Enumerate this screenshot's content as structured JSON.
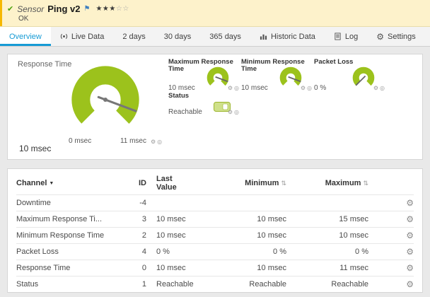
{
  "header": {
    "check_icon": "✔",
    "kind_label": "Sensor",
    "title": "Ping v2",
    "flag_icon": "⚑",
    "stars_filled": "★★★",
    "stars_empty": "☆☆",
    "status": "OK"
  },
  "tabs": [
    {
      "label": "Overview"
    },
    {
      "label": "Live Data",
      "icon": "live-data-icon"
    },
    {
      "label": "2 days"
    },
    {
      "label": "30 days"
    },
    {
      "label": "365 days"
    },
    {
      "label": "Historic Data",
      "icon": "bar-chart-icon"
    },
    {
      "label": "Log",
      "icon": "log-icon"
    },
    {
      "label": "Settings",
      "icon": "gear-icon"
    }
  ],
  "overview": {
    "gauge_title": "Response Time",
    "gauge": {
      "min_label": "0 msec",
      "max_label": "11 msec",
      "value": "10 msec"
    },
    "mini_gauges": [
      {
        "title": "Maximum Response Time",
        "value": "10 msec"
      },
      {
        "title": "Minimum Response Time",
        "value": "10 msec"
      },
      {
        "title": "Packet Loss",
        "value": "0 %"
      }
    ],
    "status": {
      "title": "Status",
      "value": "Reachable"
    }
  },
  "table": {
    "headers": {
      "channel": "Channel",
      "id": "ID",
      "last_value": "Last Value",
      "minimum": "Minimum",
      "maximum": "Maximum"
    },
    "rows": [
      {
        "channel": "Downtime",
        "id": "-4",
        "last": "",
        "min": "",
        "max": ""
      },
      {
        "channel": "Maximum Response Ti...",
        "id": "3",
        "last": "10 msec",
        "min": "10 msec",
        "max": "15 msec"
      },
      {
        "channel": "Minimum Response Time",
        "id": "2",
        "last": "10 msec",
        "min": "10 msec",
        "max": "10 msec"
      },
      {
        "channel": "Packet Loss",
        "id": "4",
        "last": "0 %",
        "min": "0 %",
        "max": "0 %"
      },
      {
        "channel": "Response Time",
        "id": "0",
        "last": "10 msec",
        "min": "10 msec",
        "max": "11 msec"
      },
      {
        "channel": "Status",
        "id": "1",
        "last": "Reachable",
        "min": "Reachable",
        "max": "Reachable"
      }
    ]
  },
  "icons": {
    "gear": "⚙",
    "pin": "◎",
    "sort_desc": "▼",
    "sort_both": "⇅"
  },
  "colors": {
    "accent_green": "#9cc21c",
    "active_tab_blue": "#169bd5",
    "header_bg": "#fdf2cb",
    "needle_gray": "#777777"
  }
}
